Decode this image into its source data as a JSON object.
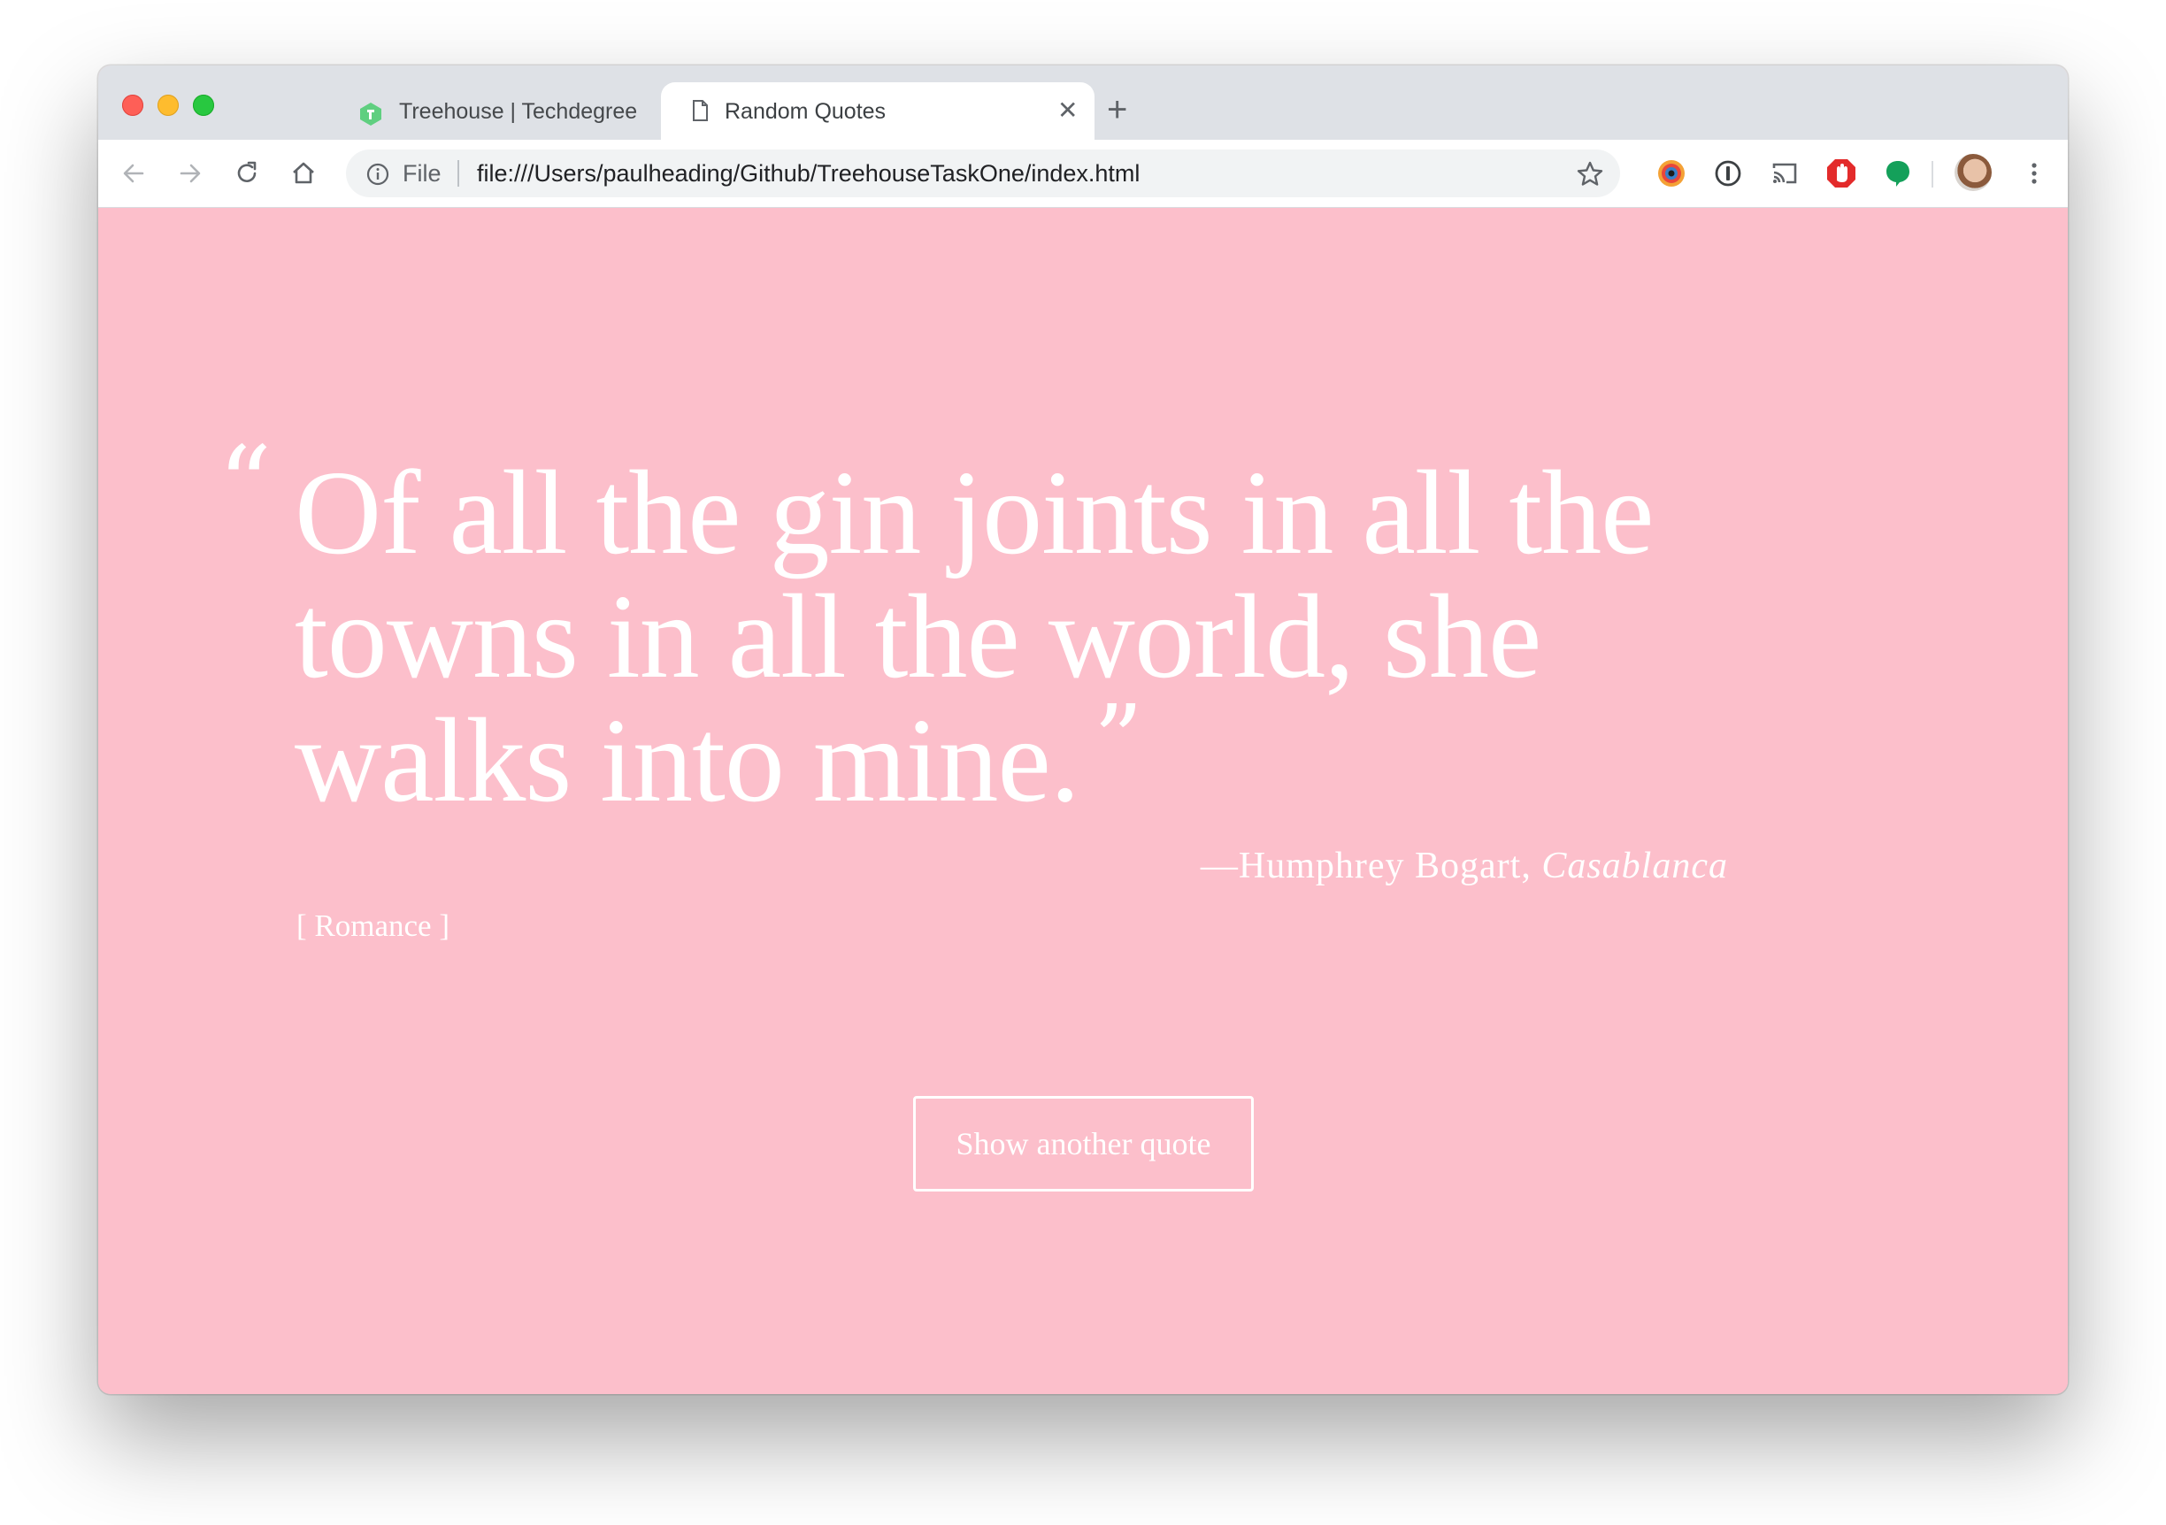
{
  "browser": {
    "tabs": [
      {
        "title": "Treehouse | Techdegree",
        "favicon": "treehouse-icon",
        "active": false
      },
      {
        "title": "Random Quotes",
        "favicon": "page-icon",
        "active": true
      }
    ],
    "new_tab_glyph": "+",
    "close_glyph": "✕",
    "address": {
      "scheme_label": "File",
      "url": "file:///Users/paulheading/Github/TreehouseTaskOne/index.html"
    },
    "extensions": [
      "eye-extension-icon",
      "1password-icon",
      "cast-icon",
      "adblock-icon",
      "green-extension-icon"
    ]
  },
  "page": {
    "background": "#fcbfcb",
    "open_quote": "“",
    "close_quote": "”",
    "quote": "Of all the gin joints in all the towns in all the world, she walks into mine.",
    "source": "—Humphrey Bogart, ",
    "citation": "Casablanca",
    "tag": "[ Romance ]",
    "button_label": "Show another quote"
  }
}
